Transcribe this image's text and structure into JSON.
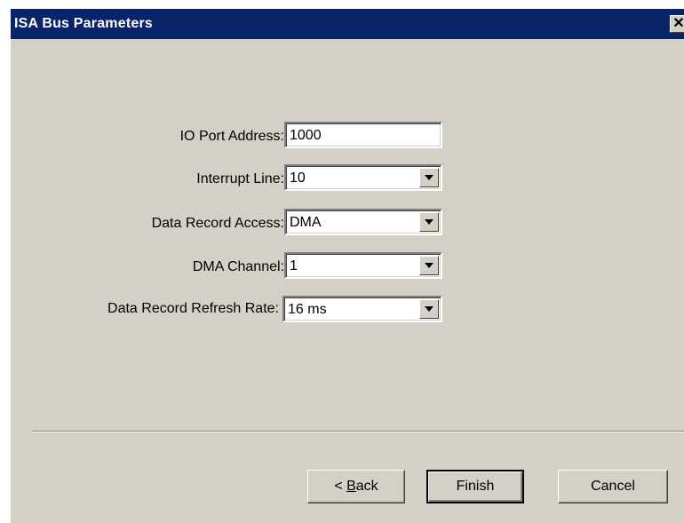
{
  "window": {
    "title": "ISA Bus Parameters",
    "close_glyph": "✕"
  },
  "form": {
    "io_port": {
      "label": "IO Port Address:",
      "value": "1000"
    },
    "interrupt": {
      "label": "Interrupt Line:",
      "value": "10"
    },
    "data_record_access": {
      "label": "Data Record Access:",
      "value": "DMA"
    },
    "dma_channel": {
      "label": "DMA Channel:",
      "value": "1"
    },
    "refresh_rate": {
      "label": "Data Record Refresh Rate:",
      "value": "16 ms"
    }
  },
  "buttons": {
    "back_prefix": "< ",
    "back_mnemonic": "B",
    "back_rest": "ack",
    "finish": "Finish",
    "cancel": "Cancel"
  }
}
